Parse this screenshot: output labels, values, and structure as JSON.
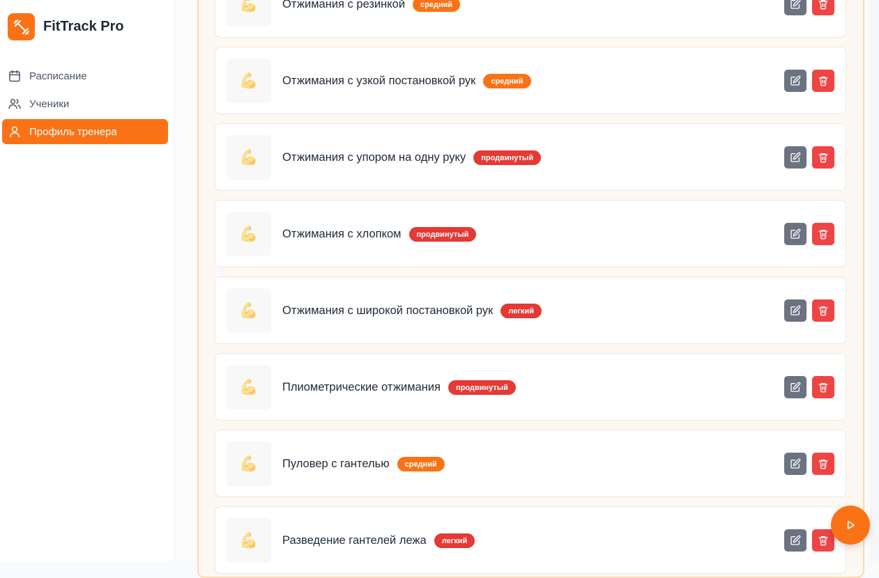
{
  "app": {
    "name": "FitTrack Pro"
  },
  "nav": [
    {
      "label": "Расписание",
      "icon": "calendar-icon",
      "active": false
    },
    {
      "label": "Ученики",
      "icon": "users-icon",
      "active": false
    },
    {
      "label": "Профиль тренера",
      "icon": "user-icon",
      "active": true
    }
  ],
  "exercises": [
    {
      "title": "Отжимания с резинкой",
      "level": "средний",
      "kind": "medium"
    },
    {
      "title": "Отжимания с узкой постановкой рук",
      "level": "средний",
      "kind": "medium"
    },
    {
      "title": "Отжимания с упором на одну руку",
      "level": "продвинутый",
      "kind": "hard"
    },
    {
      "title": "Отжимания с хлопком",
      "level": "продвинутый",
      "kind": "hard"
    },
    {
      "title": "Отжимания с широкой постановкой рук",
      "level": "легкий",
      "kind": "easy"
    },
    {
      "title": "Плиометрические отжимания",
      "level": "продвинутый",
      "kind": "hard"
    },
    {
      "title": "Пуловер с гантелью",
      "level": "средний",
      "kind": "medium"
    },
    {
      "title": "Разведение гантелей лежа",
      "level": "легкий",
      "kind": "easy"
    }
  ],
  "thumbnail_icon": "flexed-biceps-icon",
  "colors": {
    "accent": "#f97316",
    "danger": "#ef4444",
    "muted": "#6b7280"
  }
}
